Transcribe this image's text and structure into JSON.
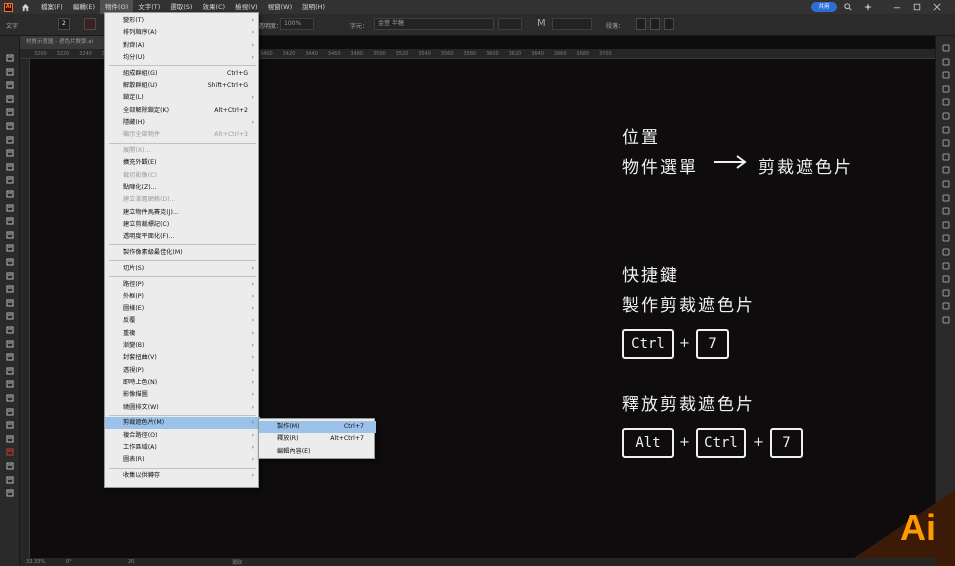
{
  "menubar": {
    "app_icon": "Ai",
    "items": [
      "檔案(F)",
      "編輯(E)",
      "物件(O)",
      "文字(T)",
      "選取(S)",
      "效果(C)",
      "檢視(V)",
      "視窗(W)",
      "說明(H)"
    ],
    "share_label": "共用",
    "icons": [
      "home-icon",
      "search-icon",
      "sparkle-icon",
      "minimize-icon",
      "maximize-icon",
      "close-icon"
    ]
  },
  "controlbar": {
    "mode_label": "文字",
    "stroke_weight": "2",
    "opacity_label": "不透明度：",
    "opacity_value": "100%",
    "char_label": "字元：",
    "font_family": "金萱 半糖",
    "font_size_label": "M",
    "paragraph_label": "段落："
  },
  "document": {
    "tab_title": "材質示意圖 - 遮色片教學.ai",
    "ruler_ticks": [
      "3200",
      "3220",
      "3240",
      "3260",
      "3280",
      "3300",
      "3320",
      "3340",
      "3360",
      "3380",
      "3400",
      "3420",
      "3440",
      "3460",
      "3480",
      "3500",
      "3520",
      "3540",
      "3560",
      "3580",
      "3600",
      "3620",
      "3640",
      "3660",
      "3680",
      "3700"
    ]
  },
  "statusbar": {
    "zoom": "33.33%",
    "rotation": "0°",
    "artboard": "20",
    "tool": "選取"
  },
  "canvas": {
    "heading_position": "位置",
    "path_from": "物件選單",
    "path_to": "剪裁遮色片",
    "heading_shortcut": "快捷鍵",
    "make_label": "製作剪裁遮色片",
    "release_label": "釋放剪裁遮色片",
    "key_ctrl": "Ctrl",
    "key_7": "7",
    "key_alt": "Alt",
    "plus": "+",
    "ai_logo": "Ai",
    "accent_color": "#ff9a00"
  },
  "object_menu": {
    "items": [
      {
        "label": "變形(T)",
        "shortcut": "",
        "submenu": true,
        "disabled": false
      },
      {
        "label": "排列順序(A)",
        "shortcut": "",
        "submenu": true,
        "disabled": false
      },
      {
        "label": "對齊(A)",
        "shortcut": "",
        "submenu": true,
        "disabled": false
      },
      {
        "label": "均分(U)",
        "shortcut": "",
        "submenu": true,
        "disabled": false
      },
      {
        "label": "組成群組(G)",
        "shortcut": "Ctrl+G",
        "submenu": false,
        "disabled": false
      },
      {
        "label": "解散群組(U)",
        "shortcut": "Shift+Ctrl+G",
        "submenu": false,
        "disabled": false
      },
      {
        "label": "鎖定(L)",
        "shortcut": "",
        "submenu": true,
        "disabled": false
      },
      {
        "label": "全部解除鎖定(K)",
        "shortcut": "Alt+Ctrl+2",
        "submenu": false,
        "disabled": false
      },
      {
        "label": "隱藏(H)",
        "shortcut": "",
        "submenu": true,
        "disabled": false
      },
      {
        "label": "顯示全部物件",
        "shortcut": "Alt+Ctrl+3",
        "submenu": false,
        "disabled": true
      },
      {
        "label": "展開(X)...",
        "shortcut": "",
        "submenu": false,
        "disabled": true
      },
      {
        "label": "擴充外觀(E)",
        "shortcut": "",
        "submenu": false,
        "disabled": false
      },
      {
        "label": "裁切影像(C)",
        "shortcut": "",
        "submenu": false,
        "disabled": true
      },
      {
        "label": "點陣化(Z)...",
        "shortcut": "",
        "submenu": false,
        "disabled": false
      },
      {
        "label": "建立漸層網格(D)...",
        "shortcut": "",
        "submenu": false,
        "disabled": true
      },
      {
        "label": "建立物件馬賽克(J)...",
        "shortcut": "",
        "submenu": false,
        "disabled": false
      },
      {
        "label": "建立剪裁標記(C)",
        "shortcut": "",
        "submenu": false,
        "disabled": false
      },
      {
        "label": "透明度平面化(F)...",
        "shortcut": "",
        "submenu": false,
        "disabled": false
      },
      {
        "label": "製作像素級最佳化(M)",
        "shortcut": "",
        "submenu": false,
        "disabled": false
      },
      {
        "label": "切片(S)",
        "shortcut": "",
        "submenu": true,
        "disabled": false
      },
      {
        "label": "路徑(P)",
        "shortcut": "",
        "submenu": true,
        "disabled": false
      },
      {
        "label": "外框(P)",
        "shortcut": "",
        "submenu": true,
        "disabled": false
      },
      {
        "label": "圖樣(E)",
        "shortcut": "",
        "submenu": true,
        "disabled": false
      },
      {
        "label": "反覆",
        "shortcut": "",
        "submenu": true,
        "disabled": false
      },
      {
        "label": "重複",
        "shortcut": "",
        "submenu": true,
        "disabled": false
      },
      {
        "label": "漸變(B)",
        "shortcut": "",
        "submenu": true,
        "disabled": false
      },
      {
        "label": "封套扭曲(V)",
        "shortcut": "",
        "submenu": true,
        "disabled": false
      },
      {
        "label": "透視(P)",
        "shortcut": "",
        "submenu": true,
        "disabled": false
      },
      {
        "label": "即時上色(N)",
        "shortcut": "",
        "submenu": true,
        "disabled": false
      },
      {
        "label": "影像描圖",
        "shortcut": "",
        "submenu": true,
        "disabled": false
      },
      {
        "label": "繞圖排文(W)",
        "shortcut": "",
        "submenu": true,
        "disabled": false
      },
      {
        "label": "剪裁遮色片(M)",
        "shortcut": "",
        "submenu": true,
        "disabled": false,
        "highlighted": true
      },
      {
        "label": "複合路徑(O)",
        "shortcut": "",
        "submenu": true,
        "disabled": false
      },
      {
        "label": "工作區域(A)",
        "shortcut": "",
        "submenu": true,
        "disabled": false
      },
      {
        "label": "圖表(R)",
        "shortcut": "",
        "submenu": true,
        "disabled": false
      },
      {
        "label": "收集以供轉存",
        "shortcut": "",
        "submenu": true,
        "disabled": false
      }
    ]
  },
  "clip_submenu": {
    "items": [
      {
        "label": "製作(M)",
        "shortcut": "Ctrl+7",
        "highlighted": true
      },
      {
        "label": "釋放(R)",
        "shortcut": "Alt+Ctrl+7",
        "highlighted": false
      },
      {
        "label": "編輯內容(E)",
        "shortcut": "",
        "highlighted": false
      }
    ]
  }
}
